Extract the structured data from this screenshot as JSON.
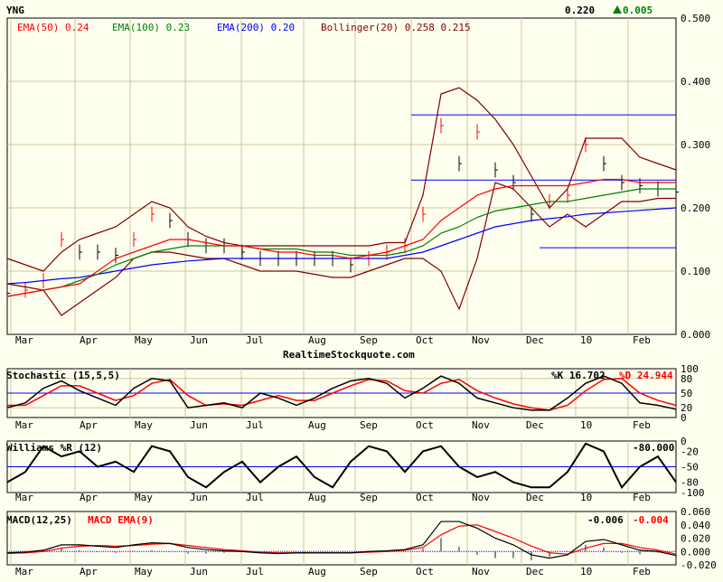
{
  "header": {
    "symbol": "YNG",
    "last": "0.220",
    "change": "0.005",
    "change_color": "#008000"
  },
  "watermark": "RealtimeStockquote.com",
  "legend": {
    "ema50": "EMA(50) 0.24",
    "ema100": "EMA(100) 0.23",
    "ema200": "EMA(200) 0.20",
    "bollinger": "Bollinger(20) 0.258 0.215"
  },
  "colors": {
    "ema50": "#ff0000",
    "ema100": "#008000",
    "ema200": "#0000ff",
    "bollinger": "#800000",
    "grid": "#c8c896"
  },
  "chart_data": [
    {
      "type": "line",
      "title": "YNG price",
      "x_labels": [
        "Mar",
        "Apr",
        "May",
        "Jun",
        "Jul",
        "Aug",
        "Sep",
        "Oct",
        "Nov",
        "Dec",
        "10",
        "Feb"
      ],
      "y_ticks": [
        "0.500",
        "0.400",
        "0.300",
        "0.200",
        "0.100",
        "0.000"
      ],
      "ylim": [
        0,
        0.5
      ],
      "close": [
        0.065,
        0.07,
        0.085,
        0.15,
        0.13,
        0.13,
        0.125,
        0.15,
        0.19,
        0.18,
        0.15,
        0.14,
        0.14,
        0.13,
        0.12,
        0.12,
        0.12,
        0.12,
        0.12,
        0.11,
        0.12,
        0.13,
        0.14,
        0.19,
        0.33,
        0.27,
        0.32,
        0.26,
        0.24,
        0.19,
        0.21,
        0.22,
        0.3,
        0.27,
        0.24,
        0.235,
        0.23,
        0.225
      ],
      "bb_upper": [
        0.12,
        0.11,
        0.1,
        0.13,
        0.15,
        0.16,
        0.17,
        0.19,
        0.21,
        0.2,
        0.17,
        0.155,
        0.145,
        0.14,
        0.14,
        0.14,
        0.14,
        0.14,
        0.14,
        0.14,
        0.14,
        0.145,
        0.145,
        0.22,
        0.38,
        0.39,
        0.37,
        0.34,
        0.3,
        0.25,
        0.2,
        0.23,
        0.31,
        0.31,
        0.31,
        0.28,
        0.27,
        0.26
      ],
      "bb_lower": [
        0.08,
        0.075,
        0.07,
        0.03,
        0.05,
        0.07,
        0.09,
        0.12,
        0.13,
        0.13,
        0.125,
        0.12,
        0.12,
        0.11,
        0.1,
        0.1,
        0.1,
        0.095,
        0.09,
        0.09,
        0.1,
        0.11,
        0.12,
        0.12,
        0.1,
        0.04,
        0.12,
        0.24,
        0.23,
        0.2,
        0.17,
        0.19,
        0.17,
        0.19,
        0.21,
        0.21,
        0.215,
        0.215
      ],
      "ema50": [
        0.06,
        0.065,
        0.07,
        0.075,
        0.08,
        0.1,
        0.12,
        0.13,
        0.14,
        0.15,
        0.15,
        0.145,
        0.14,
        0.14,
        0.135,
        0.13,
        0.13,
        0.125,
        0.125,
        0.12,
        0.125,
        0.13,
        0.14,
        0.15,
        0.18,
        0.2,
        0.22,
        0.23,
        0.235,
        0.235,
        0.235,
        0.235,
        0.24,
        0.245,
        0.245,
        0.24,
        0.24,
        0.24
      ],
      "ema100": [
        0.06,
        0.065,
        0.07,
        0.075,
        0.085,
        0.095,
        0.11,
        0.12,
        0.13,
        0.135,
        0.14,
        0.14,
        0.14,
        0.14,
        0.135,
        0.135,
        0.135,
        0.13,
        0.13,
        0.125,
        0.125,
        0.125,
        0.13,
        0.14,
        0.16,
        0.17,
        0.185,
        0.195,
        0.2,
        0.205,
        0.21,
        0.21,
        0.215,
        0.22,
        0.225,
        0.23,
        0.23,
        0.23
      ],
      "ema200": [
        0.08,
        0.082,
        0.085,
        0.088,
        0.09,
        0.095,
        0.1,
        0.105,
        0.11,
        0.113,
        0.116,
        0.118,
        0.12,
        0.12,
        0.12,
        0.12,
        0.12,
        0.12,
        0.12,
        0.12,
        0.12,
        0.12,
        0.125,
        0.13,
        0.14,
        0.15,
        0.16,
        0.17,
        0.175,
        0.18,
        0.183,
        0.186,
        0.19,
        0.192,
        0.194,
        0.196,
        0.198,
        0.2
      ],
      "levels": [
        0.347,
        0.244,
        0.137
      ]
    },
    {
      "type": "line",
      "title": "Stochastic (15,5,5)",
      "k_label": "%K 16.702",
      "d_label": "%D 24.944",
      "y_ticks": [
        "100",
        "80",
        "50",
        "20",
        "0"
      ],
      "ylim": [
        0,
        100
      ],
      "k": [
        20,
        30,
        60,
        75,
        55,
        40,
        25,
        60,
        80,
        75,
        20,
        25,
        30,
        20,
        50,
        40,
        25,
        40,
        60,
        75,
        80,
        70,
        40,
        60,
        85,
        70,
        40,
        30,
        20,
        15,
        15,
        40,
        70,
        85,
        70,
        30,
        25,
        17
      ],
      "d": [
        25,
        25,
        45,
        65,
        65,
        50,
        35,
        45,
        70,
        78,
        45,
        25,
        28,
        25,
        35,
        45,
        35,
        35,
        50,
        65,
        78,
        75,
        55,
        50,
        70,
        78,
        55,
        40,
        28,
        20,
        15,
        25,
        55,
        78,
        80,
        50,
        35,
        25
      ]
    },
    {
      "type": "line",
      "title": "Williams %R (12)",
      "value_label": "-80.000",
      "y_ticks": [
        "0",
        "-20",
        "-50",
        "-80",
        "-100"
      ],
      "ylim": [
        -100,
        0
      ],
      "r": [
        -80,
        -60,
        -10,
        -30,
        -20,
        -50,
        -40,
        -60,
        -10,
        -20,
        -70,
        -90,
        -60,
        -40,
        -80,
        -50,
        -30,
        -70,
        -90,
        -40,
        -10,
        -20,
        -60,
        -20,
        -10,
        -50,
        -70,
        -60,
        -80,
        -90,
        -90,
        -60,
        -5,
        -20,
        -90,
        -50,
        -30,
        -80
      ]
    },
    {
      "type": "bar",
      "title": "MACD(12,25)",
      "signal_title": "MACD EMA(9)",
      "macd_label": "-0.006",
      "signal_label": "-0.004",
      "y_ticks": [
        "0.060",
        "0.040",
        "0.020",
        "0.000",
        "-0.020"
      ],
      "ylim": [
        -0.02,
        0.06
      ],
      "macd": [
        -0.002,
        -0.001,
        0.002,
        0.01,
        0.01,
        0.008,
        0.006,
        0.01,
        0.013,
        0.012,
        0.006,
        0.003,
        0.001,
        0.0,
        -0.002,
        -0.003,
        -0.002,
        -0.002,
        -0.002,
        -0.002,
        0.0,
        0.001,
        0.003,
        0.01,
        0.045,
        0.045,
        0.035,
        0.02,
        0.01,
        -0.005,
        -0.01,
        -0.005,
        0.015,
        0.018,
        0.01,
        0.002,
        0.0,
        -0.006
      ],
      "signal": [
        -0.003,
        -0.002,
        0.0,
        0.005,
        0.008,
        0.009,
        0.008,
        0.009,
        0.011,
        0.012,
        0.009,
        0.006,
        0.003,
        0.001,
        -0.001,
        -0.002,
        -0.002,
        -0.002,
        -0.002,
        -0.002,
        -0.001,
        0.0,
        0.002,
        0.006,
        0.025,
        0.038,
        0.04,
        0.03,
        0.02,
        0.008,
        -0.002,
        -0.004,
        0.005,
        0.012,
        0.012,
        0.006,
        0.002,
        -0.004
      ]
    }
  ]
}
